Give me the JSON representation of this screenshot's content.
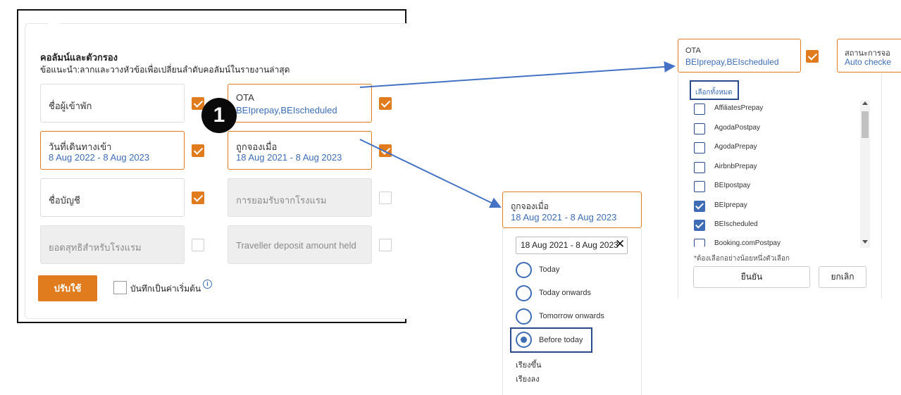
{
  "panel": {
    "title": "คอลัมน์และตัวกรอง",
    "hint": "ข้อแนะนำ:ลากและวางหัวข้อเพื่อเปลี่ยนลำดับคอลัมน์ในรายงานล่าสุด",
    "fields": {
      "guest_name": {
        "label": "ชื่อผู้เข้าพัก",
        "checked": true
      },
      "ota": {
        "label": "OTA",
        "value": "BEIprepay,BEIscheduled",
        "checked": true
      },
      "arrival_date": {
        "label": "วันที่เดินทางเข้า",
        "value": "8 Aug 2022 - 8 Aug 2023",
        "checked": true
      },
      "booked_on": {
        "label": "ถูกจองเมื่อ",
        "value": "18 Aug 2021 - 8 Aug 2023",
        "checked": true
      },
      "account_name": {
        "label": "ชื่อบัญชี",
        "checked": true
      },
      "hotel_acceptance": {
        "label": "การยอมรับจากโรงแรม",
        "checked": false
      },
      "net_hotel": {
        "label": "ยอดสุทธิสำหรับโรงแรม",
        "checked": false
      },
      "deposit": {
        "label": "Traveller deposit amount held",
        "checked": false
      }
    },
    "apply_label": "ปรับใช้",
    "save_default_label": "บันทึกเป็นค่าเริ่มต้น",
    "badge": "1"
  },
  "date_popup": {
    "label": "ถูกจองเมื่อ",
    "value": "18 Aug 2021 - 8 Aug 2023",
    "input_value": "18 Aug 2021 - 8 Aug 2023",
    "options": [
      "Today",
      "Today onwards",
      "Tomorrow onwards",
      "Before today"
    ],
    "selected": "Before today",
    "sort_asc": "เรียงขึ้น",
    "sort_desc": "เรียงลง"
  },
  "ota_popup": {
    "label": "OTA",
    "value": "BEIprepay,BEIscheduled",
    "next_label": "สถานะการจอ",
    "next_value": "Auto checke",
    "select_all": "เลือกทั้งหมด",
    "items": [
      {
        "label": "AffiliatesPrepay",
        "checked": false
      },
      {
        "label": "AgodaPostpay",
        "checked": false
      },
      {
        "label": "AgodaPrepay",
        "checked": false
      },
      {
        "label": "AirbnbPrepay",
        "checked": false
      },
      {
        "label": "BEIpostpay",
        "checked": false
      },
      {
        "label": "BEIprepay",
        "checked": true
      },
      {
        "label": "BEIscheduled",
        "checked": true
      },
      {
        "label": "Booking.comPostpay",
        "checked": false
      }
    ],
    "required_note": "*ต้องเลือกอย่างน้อยหนึ่งตัวเลือก",
    "confirm_label": "ยืนยัน",
    "cancel_label": "ยกเลิก"
  },
  "colors": {
    "accent": "#e07c1e",
    "link": "#3e6db5",
    "highlight": "#2b4a8b",
    "arrow": "#4472c4"
  }
}
